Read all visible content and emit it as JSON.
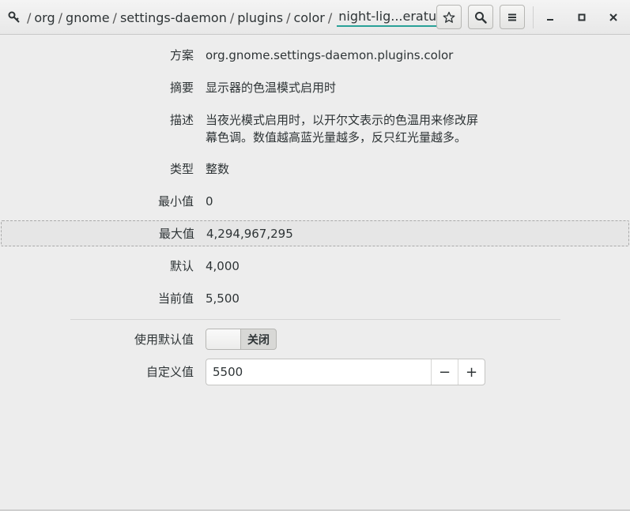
{
  "header": {
    "path_segments": [
      "org",
      "gnome",
      "settings-daemon",
      "plugins",
      "color"
    ],
    "current_key": "night-lig...erature",
    "buttons": {
      "bookmark_icon": "star-icon",
      "search_icon": "search-icon",
      "menu_icon": "hamburger-menu-icon"
    },
    "window_controls": [
      "minimize-icon",
      "maximize-icon",
      "close-icon"
    ]
  },
  "details": {
    "schema": {
      "label": "方案",
      "value": "org.gnome.settings-daemon.plugins.color"
    },
    "summary": {
      "label": "摘要",
      "value": "显示器的色温模式启用时"
    },
    "description": {
      "label": "描述",
      "line1": "当夜光模式启用时，以开尔文表示的色温用来修改屏",
      "line2": "幕色调。数值越高蓝光量越多，反只红光量越多。"
    },
    "type": {
      "label": "类型",
      "value": "整数"
    },
    "min": {
      "label": "最小值",
      "value": "0"
    },
    "max": {
      "label": "最大值",
      "value": "4,294,967,295"
    },
    "default": {
      "label": "默认",
      "value": "4,000"
    },
    "current": {
      "label": "当前值",
      "value": "5,500"
    }
  },
  "settings": {
    "use_default": {
      "label": "使用默认值",
      "state_label": "关闭",
      "on": false
    },
    "custom_value": {
      "label": "自定义值",
      "value": "5500",
      "minus": "−",
      "plus": "+"
    }
  }
}
